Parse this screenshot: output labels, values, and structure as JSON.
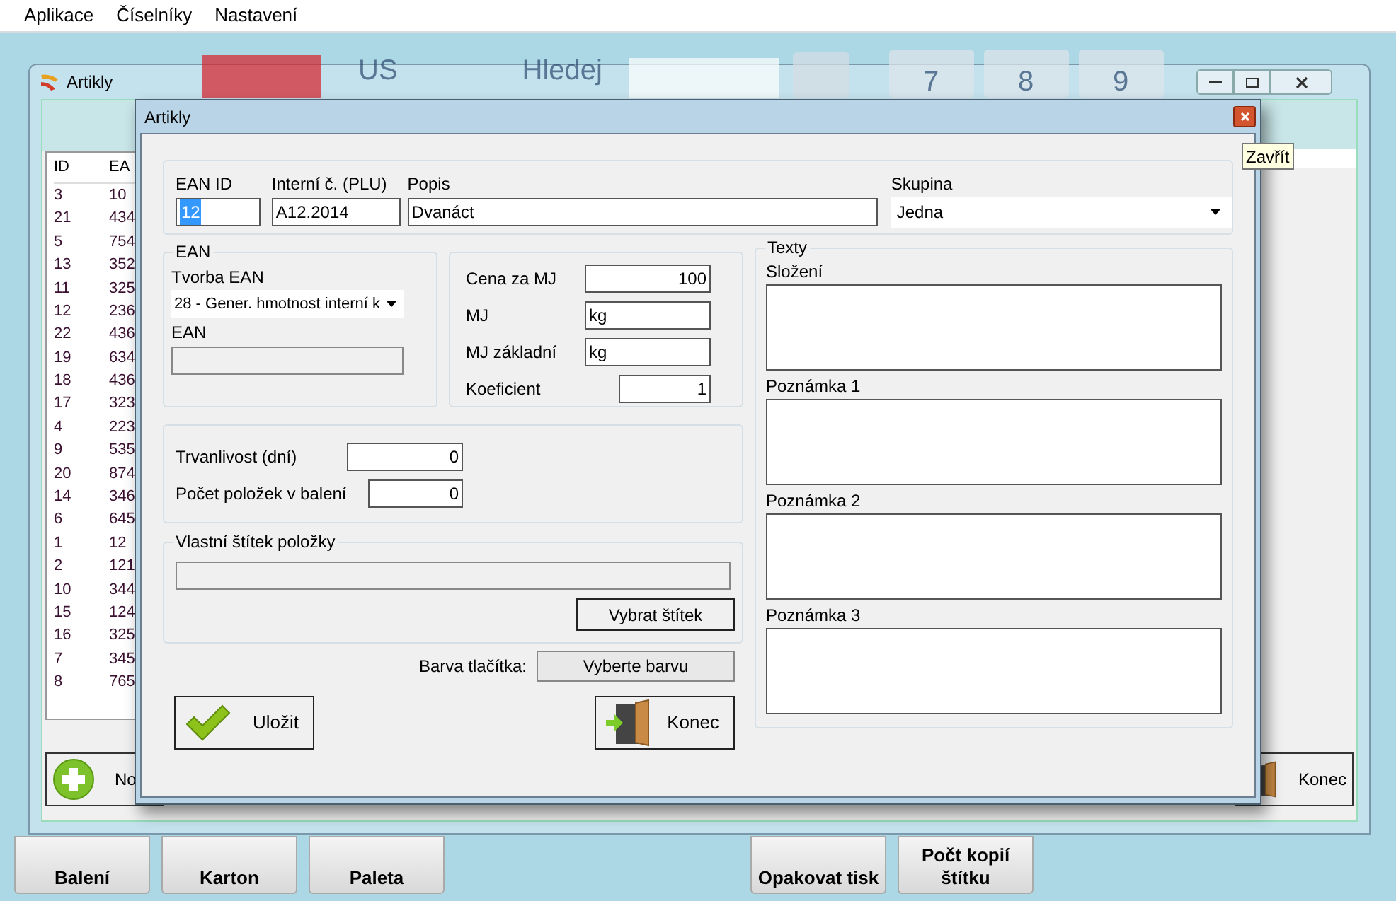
{
  "menu": [
    "Aplikace",
    "Číselníky",
    "Nastavení"
  ],
  "background_toolbar": {
    "field_label": "US",
    "search_label": "Hledej",
    "keys": [
      "7",
      "8",
      "9"
    ]
  },
  "back_window": {
    "title": "Artikly",
    "list": {
      "columns": [
        "ID",
        "EA"
      ],
      "rows": [
        [
          "3",
          "10"
        ],
        [
          "21",
          "434"
        ],
        [
          "5",
          "754"
        ],
        [
          "13",
          "352"
        ],
        [
          "11",
          "325"
        ],
        [
          "12",
          "236"
        ],
        [
          "22",
          "436"
        ],
        [
          "19",
          "634"
        ],
        [
          "18",
          "436"
        ],
        [
          "17",
          "323"
        ],
        [
          "4",
          "223"
        ],
        [
          "9",
          "535"
        ],
        [
          "20",
          "874"
        ],
        [
          "14",
          "346"
        ],
        [
          "6",
          "645"
        ],
        [
          "1",
          "12"
        ],
        [
          "2",
          "121"
        ],
        [
          "10",
          "344"
        ],
        [
          "15",
          "124"
        ],
        [
          "16",
          "325"
        ],
        [
          "7",
          "345"
        ],
        [
          "8",
          "765"
        ]
      ]
    },
    "buttons": [
      {
        "label": "No",
        "kind": "add"
      },
      {
        "label": "Konec",
        "kind": "exit"
      }
    ]
  },
  "dialog": {
    "title": "Artikly",
    "top_fields": [
      {
        "label": "EAN ID",
        "value": "12",
        "kind": "text",
        "highlighted": true
      },
      {
        "label": "Interní č. (PLU)",
        "value": "A12.2014",
        "kind": "text"
      },
      {
        "label": "Popis",
        "value": "Dvanáct",
        "kind": "text"
      },
      {
        "label": "Skupina",
        "value": "Jedna",
        "kind": "select"
      }
    ],
    "ean_group": {
      "title": "EAN",
      "creation_label": "Tvorba EAN",
      "creation_value": "28 - Gener. hmotnost interní k",
      "ean_label": "EAN"
    },
    "price_fields": [
      {
        "label": "Cena za MJ",
        "value": "100",
        "kind": "number"
      },
      {
        "label": "MJ",
        "value": "kg",
        "kind": "text"
      },
      {
        "label": "MJ základní",
        "value": "kg",
        "kind": "text"
      },
      {
        "label": "Koeficient",
        "value": "1",
        "kind": "short_number"
      }
    ],
    "shelf_fields": [
      {
        "label": "Trvanlivost (dní)",
        "value": "0"
      },
      {
        "label": "Počet položek v balení",
        "value": "0"
      }
    ],
    "label_group": {
      "title": "Vlastní štítek položky",
      "button": "Vybrat štítek"
    },
    "color_row": {
      "label": "Barva tlačítka:",
      "button": "Vyberte barvu"
    },
    "actions": [
      {
        "label": "Uložit",
        "kind": "save"
      },
      {
        "label": "Konec",
        "kind": "exit"
      }
    ],
    "texts_group": {
      "title": "Texty",
      "fields": [
        "Složení",
        "Poznámka 1",
        "Poznámka 2",
        "Poznámka 3"
      ]
    }
  },
  "tooltip": "Zavřít",
  "bottom_buttons": [
    "Balení",
    "Karton",
    "Paleta",
    "Opakovat tisk",
    "Počt kopií štítku"
  ]
}
